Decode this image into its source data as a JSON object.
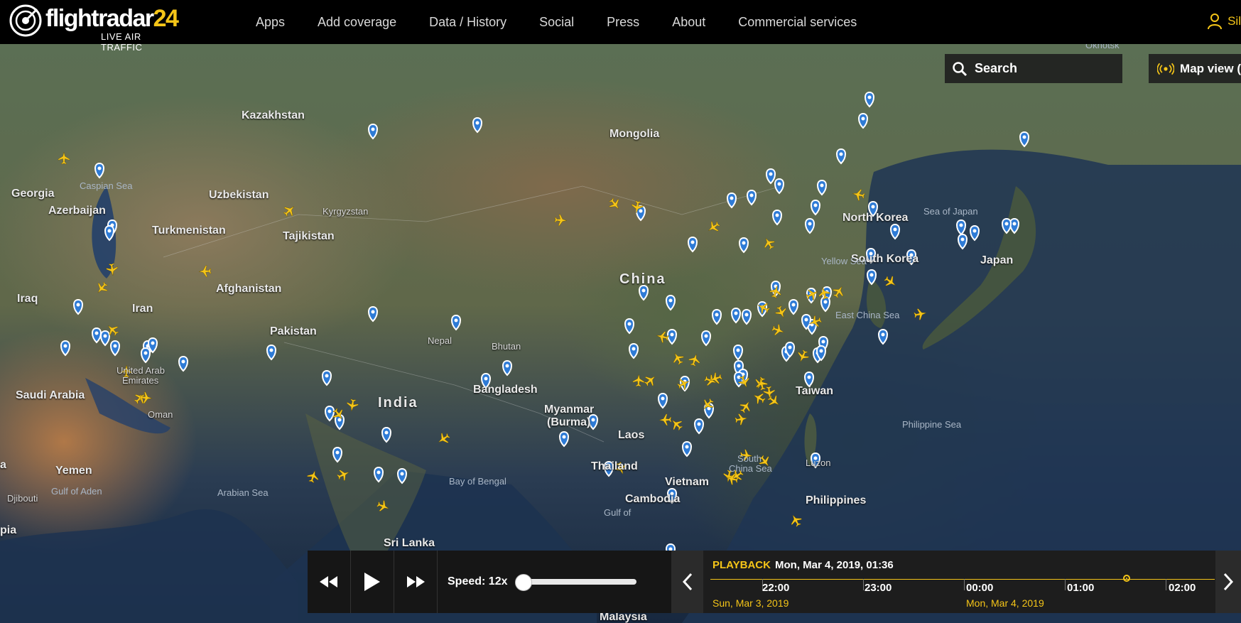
{
  "brand": {
    "name_main": "flightradar",
    "name_num": "24",
    "tagline": "LIVE AIR TRAFFIC"
  },
  "nav": {
    "items": [
      "Apps",
      "Add coverage",
      "Data / History",
      "Social",
      "Press",
      "About",
      "Commercial services"
    ]
  },
  "user": {
    "label": "Sil"
  },
  "search": {
    "label": "Search"
  },
  "map_view": {
    "label": "Map view ("
  },
  "map_labels": {
    "countries": [
      "Kazakhstan",
      "Mongolia",
      "Georgia",
      "Azerbaijan",
      "Uzbekistan",
      "Kyrgyzstan",
      "Turkmenistan",
      "Tajikistan",
      "China",
      "North Korea",
      "South Korea",
      "Japan",
      "Iraq",
      "Iran",
      "Afghanistan",
      "Pakistan",
      "Nepal",
      "Bhutan",
      "India",
      "Bangladesh",
      "Myanmar",
      "(Burma)",
      "Laos",
      "Thailand",
      "Vietnam",
      "Cambodia",
      "Philippines",
      "Taiwan",
      "Luzon",
      "Saudi Arabia",
      "United Arab",
      "Emirates",
      "Oman",
      "Yemen",
      "Djibouti",
      "Sri Lanka",
      "Malaysia",
      "Okhotsk",
      "pia",
      "a"
    ],
    "seas": [
      "Caspian Sea",
      "Sea of Japan",
      "Yellow Sea",
      "East China Sea",
      "Philippine Sea",
      "South",
      "China Sea",
      "Bay of Bengal",
      "Arabian Sea",
      "Gulf of Aden",
      "Gulf of"
    ]
  },
  "playback": {
    "title": "PLAYBACK",
    "current": "Mon, Mar 4, 2019, 01:36",
    "speed_label": "Speed: 12x",
    "speed_fraction": 0.0,
    "hours": [
      "22:00",
      "23:00",
      "00:00",
      "01:00",
      "02:00"
    ],
    "dates": [
      "Sun, Mar 3, 2019",
      "Mon, Mar 4, 2019"
    ]
  },
  "colors": {
    "accent": "#f5c518",
    "topbar": "#000000",
    "marker": "#2e7bd6",
    "plane": "#f5c518"
  },
  "icons": [
    "radar-logo-icon",
    "user-icon",
    "search-icon",
    "radar-signal-icon",
    "rewind-icon",
    "play-icon",
    "fast-forward-icon",
    "chevron-left-icon",
    "chevron-right-icon",
    "airport-marker-icon",
    "airplane-icon"
  ]
}
